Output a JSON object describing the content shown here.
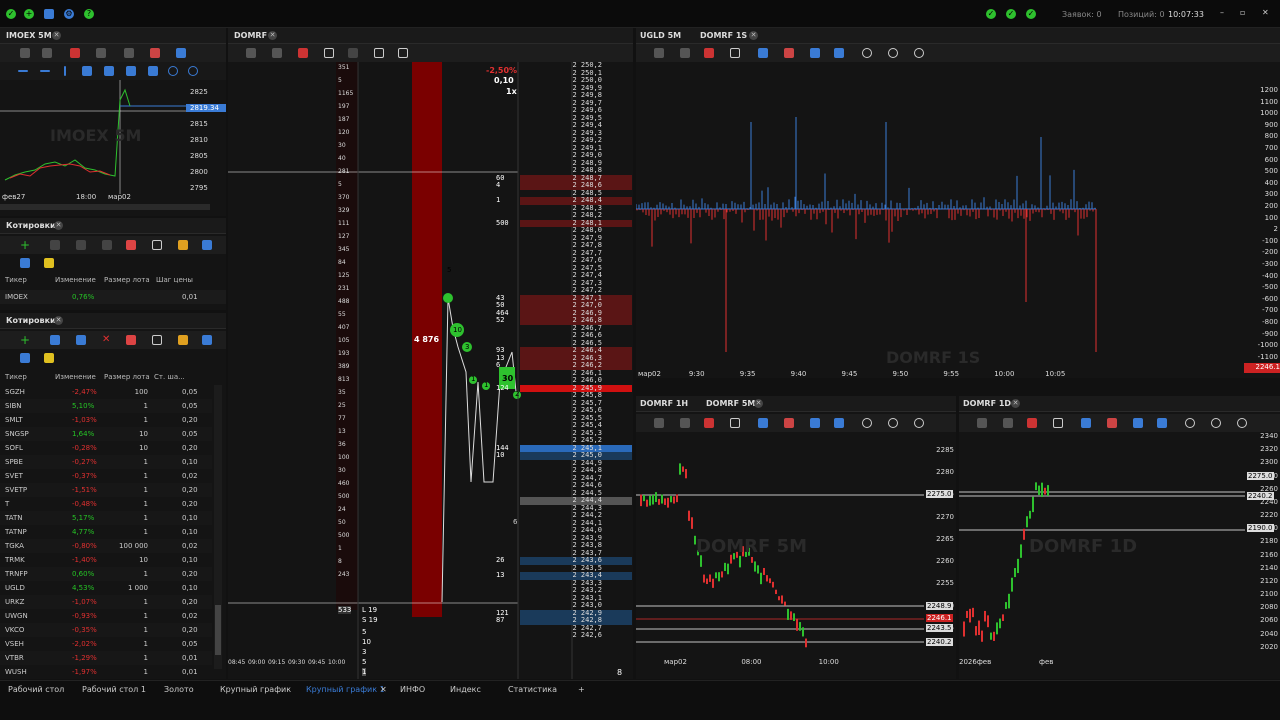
{
  "topbar": {
    "orders": "Заявок: 0",
    "positions": "Позиций: 0",
    "clock": "10:07:33",
    "ok_icons": 3
  },
  "imoex": {
    "title": "IMOEX 5M",
    "watermark": "IMOEX 5M",
    "price_axis": [
      "2825",
      "2815",
      "2810",
      "2805",
      "2800",
      "2795"
    ],
    "time_axis": [
      "фев27",
      "18:00",
      "мар02"
    ],
    "current_price": "2819.34"
  },
  "quotes1": {
    "title": "Котировки",
    "columns": [
      "Тикер",
      "Изменение",
      "Размер лота",
      "Шаг цены"
    ],
    "rows": [
      {
        "ticker": "IMOEX",
        "change": "0,76%",
        "lot": "",
        "step": "0,01"
      }
    ]
  },
  "quotes2": {
    "title": "Котировки",
    "columns": [
      "Тикер",
      "Изменение",
      "Размер лота",
      "Ст. ша..."
    ],
    "rows": [
      {
        "ticker": "SGZH",
        "change": "-2,47%",
        "lot": "100",
        "step": "0,05",
        "up": false
      },
      {
        "ticker": "SIBN",
        "change": "5,10%",
        "lot": "1",
        "step": "0,05",
        "up": true
      },
      {
        "ticker": "SMLT",
        "change": "-1,03%",
        "lot": "1",
        "step": "0,20",
        "up": false
      },
      {
        "ticker": "SNGSP",
        "change": "1,64%",
        "lot": "10",
        "step": "0,05",
        "up": true
      },
      {
        "ticker": "SOFL",
        "change": "-0,28%",
        "lot": "10",
        "step": "0,20",
        "up": false
      },
      {
        "ticker": "SPBE",
        "change": "-0,27%",
        "lot": "1",
        "step": "0,10",
        "up": false
      },
      {
        "ticker": "SVET",
        "change": "-0,37%",
        "lot": "1",
        "step": "0,02",
        "up": false
      },
      {
        "ticker": "SVETP",
        "change": "-1,51%",
        "lot": "1",
        "step": "0,20",
        "up": false
      },
      {
        "ticker": "T",
        "change": "-0,48%",
        "lot": "1",
        "step": "0,20",
        "up": false
      },
      {
        "ticker": "TATN",
        "change": "5,17%",
        "lot": "1",
        "step": "0,10",
        "up": true
      },
      {
        "ticker": "TATNP",
        "change": "4,77%",
        "lot": "1",
        "step": "0,10",
        "up": true
      },
      {
        "ticker": "TGKA",
        "change": "-0,80%",
        "lot": "100 000",
        "step": "0,02",
        "up": false
      },
      {
        "ticker": "TRMK",
        "change": "-1,40%",
        "lot": "10",
        "step": "0,10",
        "up": false
      },
      {
        "ticker": "TRNFP",
        "change": "0,60%",
        "lot": "1",
        "step": "0,20",
        "up": true
      },
      {
        "ticker": "UGLD",
        "change": "4,53%",
        "lot": "1 000",
        "step": "0,10",
        "up": true
      },
      {
        "ticker": "URKZ",
        "change": "-1,07%",
        "lot": "1",
        "step": "0,20",
        "up": false
      },
      {
        "ticker": "UWGN",
        "change": "-0,93%",
        "lot": "1",
        "step": "0,02",
        "up": false
      },
      {
        "ticker": "VKCO",
        "change": "-0,35%",
        "lot": "1",
        "step": "0,20",
        "up": false
      },
      {
        "ticker": "VSEH",
        "change": "-2,02%",
        "lot": "1",
        "step": "0,05",
        "up": false
      },
      {
        "ticker": "VTBR",
        "change": "-1,29%",
        "lot": "1",
        "step": "0,01",
        "up": false
      },
      {
        "ticker": "WUSH",
        "change": "-1,97%",
        "lot": "1",
        "step": "0,01",
        "up": false
      }
    ]
  },
  "domrf": {
    "title": "DOMRF",
    "change": "-2,50%",
    "step": "0,10",
    "mult": "1x",
    "bar_volume": "4 876",
    "bubbles": [
      "5",
      "10",
      "3",
      "1",
      "1",
      "30",
      "2"
    ],
    "times": [
      "08:45",
      "09:00",
      "09:15",
      "09:30",
      "09:45",
      "10:00"
    ],
    "l_label": "L 19",
    "s_label": "S 19",
    "ladder": [
      "2 250,2",
      "2 250,1",
      "2 250,0",
      "2 249,9",
      "2 249,8",
      "2 249,7",
      "2 249,6",
      "2 249,5",
      "2 249,4",
      "2 249,3",
      "2 249,2",
      "2 249,1",
      "2 249,0",
      "2 248,9",
      "2 248,8",
      "2 248,7",
      "2 248,6",
      "2 248,5",
      "2 248,4",
      "2 248,3",
      "2 248,2",
      "2 248,1",
      "2 248,0",
      "2 247,9",
      "2 247,8",
      "2 247,7",
      "2 247,6",
      "2 247,5",
      "2 247,4",
      "2 247,3",
      "2 247,2",
      "2 247,1",
      "2 247,0",
      "2 246,9",
      "2 246,8",
      "2 246,7",
      "2 246,6",
      "2 246,5",
      "2 246,4",
      "2 246,3",
      "2 246,2",
      "2 246,1",
      "2 246,0",
      "2 245,9",
      "2 245,8",
      "2 245,7",
      "2 245,6",
      "2 245,5",
      "2 245,4",
      "2 245,3",
      "2 245,2",
      "2 245,1",
      "2 245,0",
      "2 244,9",
      "2 244,8",
      "2 244,7",
      "2 244,6",
      "2 244,5",
      "2 244,4",
      "2 244,3",
      "2 244,2",
      "2 244,1",
      "2 244,0",
      "2 243,9",
      "2 243,8",
      "2 243,7",
      "2 243,6",
      "2 243,5",
      "2 243,4",
      "2 243,3",
      "2 243,2",
      "2 243,1",
      "2 243,0",
      "2 242,9",
      "2 242,8",
      "2 242,7",
      "2 242,6"
    ],
    "asks": [
      {
        "i": 15,
        "v": "60"
      },
      {
        "i": 16,
        "v": "4"
      },
      {
        "i": 18,
        "v": "1"
      },
      {
        "i": 21,
        "v": "500"
      },
      {
        "i": 31,
        "v": "43"
      },
      {
        "i": 32,
        "v": "50"
      },
      {
        "i": 33,
        "v": "464"
      },
      {
        "i": 34,
        "v": "52"
      },
      {
        "i": 38,
        "v": "93"
      },
      {
        "i": 39,
        "v": "13"
      },
      {
        "i": 40,
        "v": "6"
      },
      {
        "i": 43,
        "v": "124"
      }
    ],
    "bids": [
      {
        "i": 51,
        "v": "144"
      },
      {
        "i": 52,
        "v": "10"
      },
      {
        "i": 66,
        "v": "26"
      },
      {
        "i": 68,
        "v": "13"
      },
      {
        "i": 73,
        "v": "121"
      },
      {
        "i": 74,
        "v": "87"
      },
      {
        "i": 77,
        "v": "2"
      },
      {
        "i": 78,
        "v": "50"
      }
    ],
    "left_vols": [
      "351",
      "5",
      "1165",
      "197",
      "187",
      "120",
      "30",
      "40",
      "281",
      "5",
      "370",
      "329",
      "111",
      "127",
      "345",
      "84",
      "125",
      "231",
      "488",
      "55",
      "407",
      "105",
      "193",
      "389",
      "813",
      "35",
      "25",
      "77",
      "13",
      "36",
      "100",
      "30",
      "460",
      "500",
      "24",
      "50",
      "500",
      "1",
      "8",
      "243"
    ],
    "bottom_nums": [
      "533",
      "5",
      "10",
      "3",
      "5",
      "1"
    ],
    "footer_num": "8",
    "ladder_marker": "6"
  },
  "ugld": {
    "tabs": [
      "UGLD 5M",
      "DOMRF 1S"
    ],
    "watermark": "DOMRF 1S",
    "price_axis": [
      "1200",
      "1100",
      "1000",
      "900",
      "800",
      "700",
      "600",
      "500",
      "400",
      "300",
      "200",
      "100",
      "2",
      "-100",
      "-200",
      "-300",
      "-400",
      "-500",
      "-600",
      "-700",
      "-800",
      "-900",
      "-1000",
      "-1100",
      "-1200"
    ],
    "time_axis": [
      "мар02",
      "9:30",
      "9:35",
      "9:40",
      "9:45",
      "9:50",
      "9:55",
      "10:00",
      "10:05"
    ],
    "last": "2246.1"
  },
  "domrf1h": {
    "tabs": [
      "DOMRF 1H",
      "DOMRF 5M"
    ],
    "watermark": "DOMRF 5M",
    "price_axis": [
      "2285",
      "2280",
      "2275",
      "2270",
      "2265",
      "2260",
      "2255",
      "2250",
      "2245"
    ],
    "marks": [
      "2275.0",
      "2248.9",
      "2246.1",
      "2243.5",
      "2240.2"
    ],
    "time_axis": [
      "мар02",
      "08:00",
      "10:00"
    ]
  },
  "domrf1d": {
    "tabs": [
      "DOMRF 1D"
    ],
    "watermark": "DOMRF 1D",
    "price_axis": [
      "2340",
      "2320",
      "2300",
      "2280",
      "2260",
      "2240",
      "2220",
      "2200",
      "2180",
      "2160",
      "2140",
      "2120",
      "2100",
      "2080",
      "2060",
      "2040",
      "2020"
    ],
    "marks": [
      "2275.0",
      "2240.2",
      "2190.0"
    ],
    "time_axis": [
      "2026фев",
      "фев"
    ]
  },
  "bottom_tabs": [
    "Рабочий стол",
    "Рабочий стол 1",
    "Золото",
    "Крупный график",
    "Крупный график 1",
    "ИНФО",
    "Индекс",
    "Статистика"
  ]
}
